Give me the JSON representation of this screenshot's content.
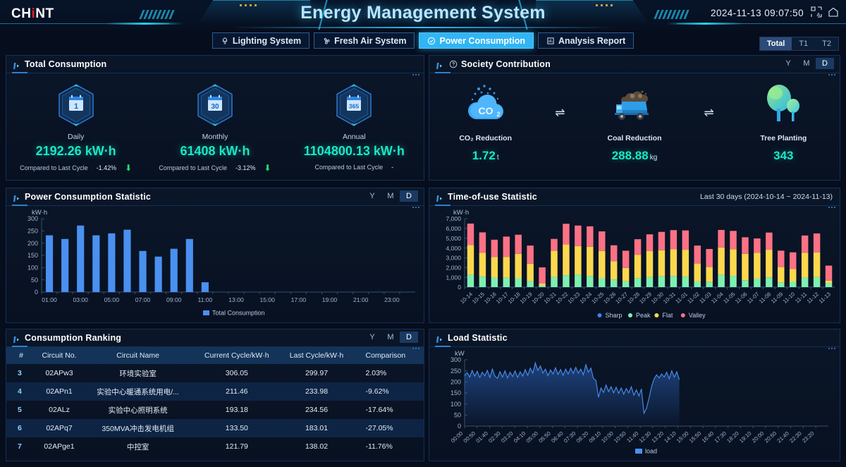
{
  "header": {
    "logo": "CHNT",
    "title": "Energy Management System",
    "datetime": "2024-11-13 09:07:50",
    "lang_icon": "translate-icon",
    "home_icon": "home-icon"
  },
  "tabs": [
    {
      "label": "Lighting System",
      "icon": "lamp-icon",
      "active": false
    },
    {
      "label": "Fresh Air System",
      "icon": "fan-icon",
      "active": false
    },
    {
      "label": "Power Consumption",
      "icon": "power-icon",
      "active": true
    },
    {
      "label": "Analysis Report",
      "icon": "report-icon",
      "active": false
    }
  ],
  "meter_selector": {
    "options": [
      "Total",
      "T1",
      "T2"
    ],
    "selected": "Total"
  },
  "total_consumption": {
    "title": "Total Consumption",
    "compare_label": "Compared to Last Cycle",
    "items": [
      {
        "icon": "calendar-1-icon",
        "badge": "1",
        "label": "Daily",
        "value": "2192.26 kW·h",
        "change": "-1.42%",
        "trend": "down"
      },
      {
        "icon": "calendar-30-icon",
        "badge": "30",
        "label": "Monthly",
        "value": "61408 kW·h",
        "change": "-3.12%",
        "trend": "down"
      },
      {
        "icon": "calendar-365-icon",
        "badge": "365",
        "label": "Annual",
        "value": "1104800.13 kW·h",
        "change": "-",
        "trend": "none"
      }
    ]
  },
  "society": {
    "title": "Society Contribution",
    "period": {
      "options": [
        "Y",
        "M",
        "D"
      ],
      "selected": "D"
    },
    "items": [
      {
        "icon": "co2-cloud-icon",
        "name": "CO₂ Reduction",
        "value": "1.72",
        "unit": "t"
      },
      {
        "icon": "coal-truck-icon",
        "name": "Coal Reduction",
        "value": "288.88",
        "unit": "kg"
      },
      {
        "icon": "tree-icon",
        "name": "Tree Planting",
        "value": "343",
        "unit": ""
      }
    ],
    "equiv_symbol": "⇌"
  },
  "power_statistic": {
    "title": "Power Consumption Statistic",
    "period": {
      "options": [
        "Y",
        "M",
        "D"
      ],
      "selected": "D"
    },
    "chart_data": {
      "type": "bar",
      "title": "Power Consumption Statistic",
      "ylabel": "kW·h",
      "xlabel": "",
      "ylim": [
        0,
        300
      ],
      "yticks": [
        0,
        50,
        100,
        150,
        200,
        250,
        300
      ],
      "xticks": [
        "01:00",
        "03:00",
        "05:00",
        "07:00",
        "09:00",
        "11:00",
        "13:00",
        "15:00",
        "17:00",
        "19:00",
        "21:00",
        "23:00"
      ],
      "categories": [
        "01:00",
        "02:00",
        "03:00",
        "04:00",
        "05:00",
        "06:00",
        "07:00",
        "08:00",
        "09:00",
        "10:00",
        "11:00",
        "12:00",
        "13:00",
        "14:00",
        "15:00",
        "16:00",
        "17:00",
        "18:00",
        "19:00",
        "20:00",
        "21:00",
        "22:00",
        "23:00",
        "24:00"
      ],
      "series": [
        {
          "name": "Total Consumption",
          "color": "#4a90f0",
          "values": [
            232,
            217,
            272,
            232,
            240,
            255,
            168,
            145,
            177,
            217,
            40,
            null,
            null,
            null,
            null,
            null,
            null,
            null,
            null,
            null,
            null,
            null,
            null,
            null
          ]
        }
      ],
      "legend": [
        "Total Consumption"
      ],
      "legend_position": "bottom",
      "grid": false
    }
  },
  "tou_statistic": {
    "title": "Time-of-use Statistic",
    "range_note": "Last 30 days  (2024-10-14 ~ 2024-11-13)",
    "chart_data": {
      "type": "bar",
      "stacked": true,
      "title": "Time-of-use Statistic",
      "ylabel": "kW·h",
      "xlabel": "",
      "ylim": [
        0,
        7000
      ],
      "yticks": [
        0,
        1000,
        2000,
        3000,
        4000,
        5000,
        6000,
        7000
      ],
      "categories": [
        "10-14",
        "10-15",
        "10-16",
        "10-17",
        "10-18",
        "10-19",
        "10-20",
        "10-21",
        "10-22",
        "10-23",
        "10-24",
        "10-25",
        "10-26",
        "10-27",
        "10-28",
        "10-29",
        "10-30",
        "10-31",
        "11-01",
        "11-02",
        "11-03",
        "11-04",
        "11-05",
        "11-06",
        "11-07",
        "11-08",
        "11-09",
        "11-10",
        "11-11",
        "11-12",
        "11-13"
      ],
      "series": [
        {
          "name": "Sharp",
          "color": "#3b82f6",
          "values": [
            0,
            0,
            0,
            0,
            0,
            0,
            0,
            0,
            0,
            0,
            0,
            0,
            0,
            0,
            0,
            0,
            0,
            0,
            0,
            0,
            0,
            0,
            0,
            0,
            0,
            0,
            0,
            0,
            0,
            0,
            0
          ]
        },
        {
          "name": "Peak",
          "color": "#7ef0b0",
          "values": [
            1270,
            1060,
            970,
            950,
            900,
            620,
            180,
            1040,
            1220,
            1270,
            1130,
            900,
            780,
            590,
            930,
            1020,
            1100,
            1130,
            1060,
            580,
            520,
            1250,
            1150,
            700,
            870,
            1000,
            450,
            540,
            980,
            1020,
            400
          ]
        },
        {
          "name": "Flat",
          "color": "#fbd84e",
          "values": [
            3030,
            2440,
            2120,
            2140,
            2500,
            1770,
            180,
            2670,
            3140,
            2930,
            3000,
            2800,
            1860,
            1370,
            2380,
            2660,
            2670,
            2730,
            2760,
            1830,
            1530,
            2800,
            2730,
            2700,
            2640,
            2820,
            1600,
            1300,
            2530,
            2520,
            270
          ]
        },
        {
          "name": "Valley",
          "color": "#fb7185",
          "values": [
            2200,
            2100,
            1760,
            2080,
            1960,
            1860,
            1660,
            1220,
            2120,
            2100,
            2090,
            2000,
            1640,
            1760,
            1590,
            1720,
            1880,
            1970,
            1980,
            1840,
            1850,
            1800,
            1870,
            1700,
            1470,
            1760,
            1680,
            1720,
            1770,
            1950,
            1530
          ]
        }
      ],
      "legend": [
        "Sharp",
        "Peak",
        "Flat",
        "Valley"
      ],
      "legend_position": "bottom",
      "grid": false
    }
  },
  "ranking": {
    "title": "Consumption Ranking",
    "period": {
      "options": [
        "Y",
        "M",
        "D"
      ],
      "selected": "D"
    },
    "columns": [
      "#",
      "Circuit No.",
      "Circuit Name",
      "Current Cycle/kW·h",
      "Last Cycle/kW·h",
      "Comparison"
    ],
    "rows": [
      {
        "idx": "3",
        "no": "02APw3",
        "name": "环境实验室",
        "current": "306.05",
        "last": "299.97",
        "comparison": "2.03%"
      },
      {
        "idx": "4",
        "no": "02APn1",
        "name": "实验中心暖通系统用电/...",
        "current": "211.46",
        "last": "233.98",
        "comparison": "-9.62%"
      },
      {
        "idx": "5",
        "no": "02ALz",
        "name": "实验中心照明系统",
        "current": "193.18",
        "last": "234.56",
        "comparison": "-17.64%"
      },
      {
        "idx": "6",
        "no": "02APq7",
        "name": "350MVA冲击发电机组",
        "current": "133.50",
        "last": "183.01",
        "comparison": "-27.05%"
      },
      {
        "idx": "7",
        "no": "02APge1",
        "name": "中控室",
        "current": "121.79",
        "last": "138.02",
        "comparison": "-11.76%"
      }
    ]
  },
  "load_statistic": {
    "title": "Load Statistic",
    "chart_data": {
      "type": "line",
      "title": "Load Statistic",
      "ylabel": "kW",
      "xlabel": "",
      "ylim": [
        0,
        300
      ],
      "yticks": [
        0,
        50,
        100,
        150,
        200,
        250,
        300
      ],
      "xticks": [
        "00:00",
        "00:50",
        "01:40",
        "02:30",
        "03:20",
        "04:10",
        "05:00",
        "05:50",
        "06:40",
        "07:30",
        "08:20",
        "09:10",
        "10:00",
        "10:50",
        "11:40",
        "12:30",
        "13:20",
        "14:10",
        "15:00",
        "15:50",
        "16:40",
        "17:30",
        "18:20",
        "19:10",
        "20:00",
        "20:50",
        "21:40",
        "22:30",
        "23:20"
      ],
      "legend": [
        "load"
      ],
      "legend_position": "bottom",
      "series": [
        {
          "name": "load",
          "color": "#4a90f0",
          "values": [
            228,
            242,
            222,
            252,
            226,
            248,
            220,
            244,
            228,
            252,
            220,
            258,
            226,
            216,
            246,
            222,
            250,
            218,
            244,
            224,
            250,
            220,
            246,
            226,
            256,
            230,
            262,
            240,
            286,
            252,
            272,
            240,
            258,
            228,
            254,
            236,
            264,
            234,
            256,
            230,
            258,
            236,
            262,
            238,
            266,
            240,
            258,
            232,
            278,
            244,
            262,
            216,
            206,
            130,
            172,
            152,
            186,
            156,
            178,
            150,
            176,
            148,
            172,
            144,
            170,
            150,
            178,
            140,
            164,
            136,
            168,
            58,
            80,
            126,
            178,
            214,
            232,
            218,
            236,
            222,
            244,
            214,
            250,
            222,
            246,
            210
          ]
        }
      ],
      "grid": false,
      "data_end_x": "10:10"
    }
  }
}
